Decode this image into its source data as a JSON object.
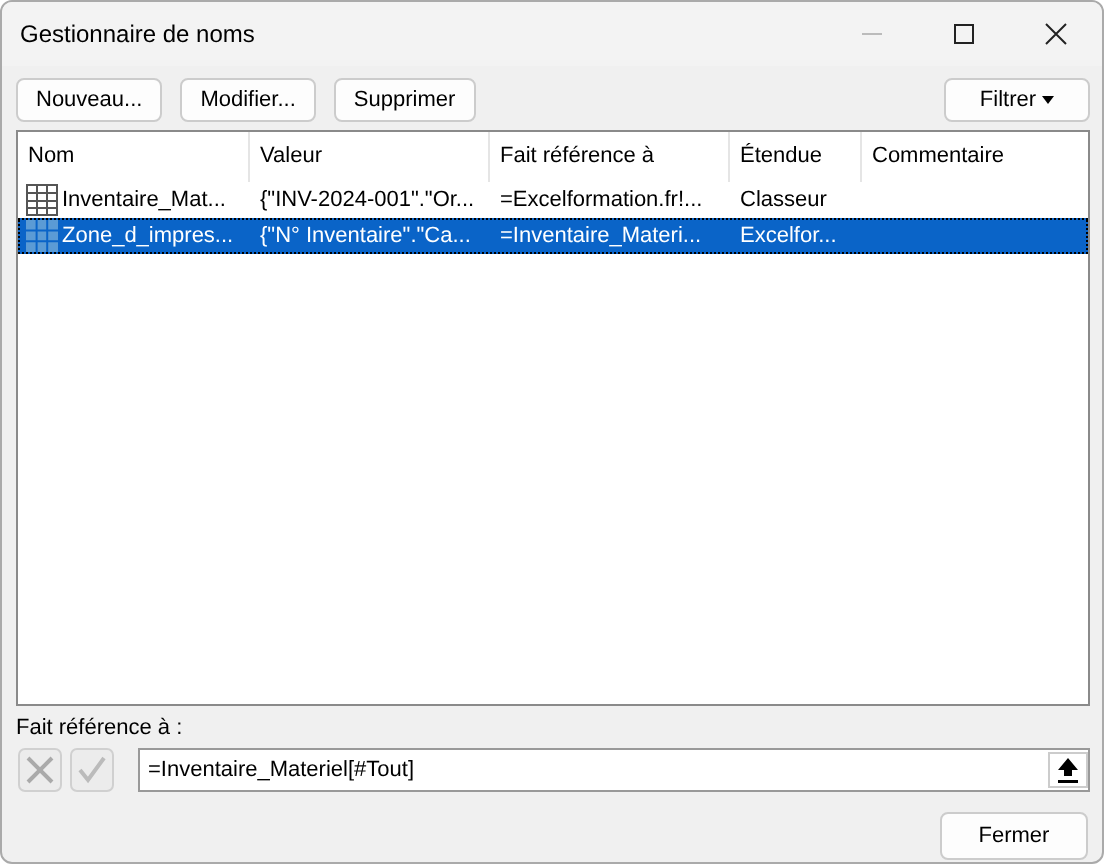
{
  "window": {
    "title": "Gestionnaire de noms"
  },
  "toolbar": {
    "buttons": [
      "Nouveau...",
      "Modifier...",
      "Supprimer"
    ],
    "filter": "Filtrer"
  },
  "table": {
    "columns": [
      "Nom",
      "Valeur",
      "Fait référence à",
      "Étendue",
      "Commentaire"
    ],
    "rows": [
      {
        "kind": "table",
        "selected": false,
        "cells": [
          "Inventaire_Mat...",
          "{\"INV-2024-001\".\"Or...",
          "=Excelformation.fr!...",
          "Classeur"
        ]
      },
      {
        "kind": "range",
        "selected": true,
        "cells": [
          "Zone_d_impres...",
          "{\"N° Inventaire\".\"Ca...",
          "=Inventaire_Materi...",
          "Excelfor..."
        ]
      }
    ]
  },
  "refers_to": {
    "label": "Fait référence à :",
    "value": "=Inventaire_Materiel[#Tout]"
  },
  "close_button": "Fermer"
}
